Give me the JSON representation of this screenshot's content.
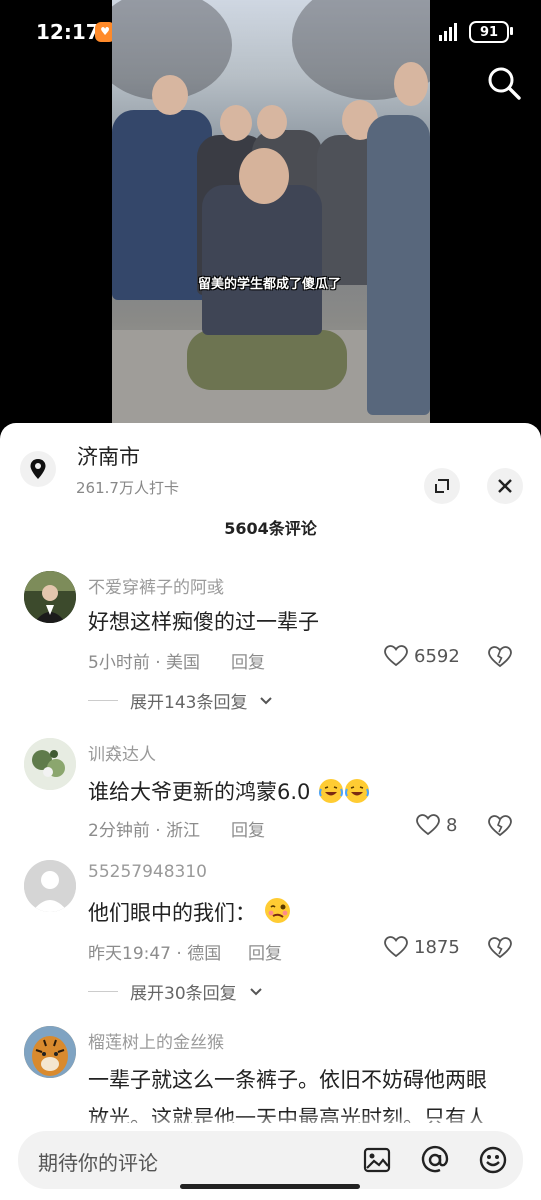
{
  "status_bar": {
    "time": "12:17",
    "network": "5G",
    "battery": "91"
  },
  "video": {
    "caption": "留美的学生都成了傻瓜了"
  },
  "location": {
    "title": "济南市",
    "subtitle": "261.7万人打卡"
  },
  "comments_header": {
    "title": "5604条评论"
  },
  "comments": [
    {
      "username": "不爱穿裤子的阿彧",
      "text": "好想这样痴傻的过一辈子",
      "meta": "5小时前 · 美国",
      "reply_label": "回复",
      "likes": "6592",
      "expand_label": "展开143条回复"
    },
    {
      "username": "训猋达人",
      "text": "谁给大爷更新的鸿蒙6.0",
      "meta": "2分钟前 · 浙江",
      "reply_label": "回复",
      "likes": "8"
    },
    {
      "username": "55257948310",
      "text": "他们眼中的我们：",
      "meta": "昨天19:47 · 德国",
      "reply_label": "回复",
      "likes": "1875",
      "expand_label": "展开30条回复"
    },
    {
      "username": "榴莲树上的金丝猴",
      "text_line1": "一辈子就这么一条裤子。依旧不妨碍他两眼",
      "text_line2": "放光。这就是他一天中最高光时刻。只有人"
    }
  ],
  "input": {
    "placeholder": "期待你的评论"
  },
  "icons": [
    "search-icon",
    "location-pin-icon",
    "expand-icon",
    "close-icon",
    "heart-icon",
    "dislike-icon",
    "image-icon",
    "at-icon",
    "emoji-icon",
    "chevron-down-icon"
  ]
}
